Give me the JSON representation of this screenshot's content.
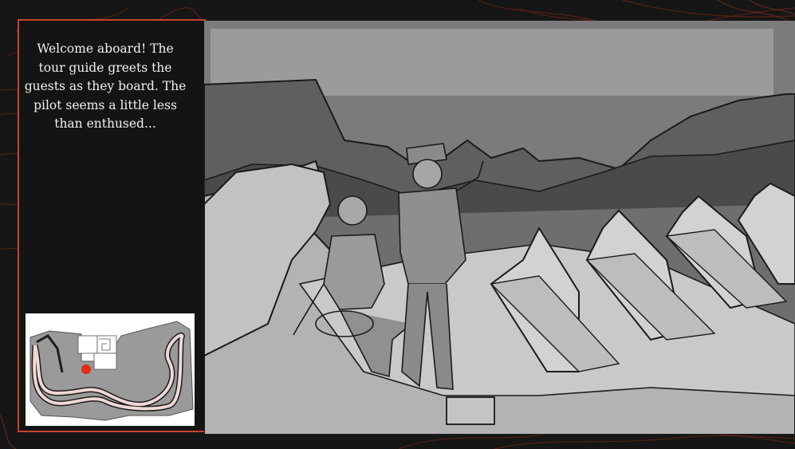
{
  "story_panel": {
    "caption": "Welcome aboard! The tour guide greets the guests as they board. The pilot seems a little less than enthused..."
  },
  "minimap": {
    "marker_color": "#e32b17",
    "track_color": "#f0d8d6"
  },
  "theme": {
    "accent": "#c2452a",
    "background": "#161616",
    "caption_text": "#f4f0ea"
  }
}
